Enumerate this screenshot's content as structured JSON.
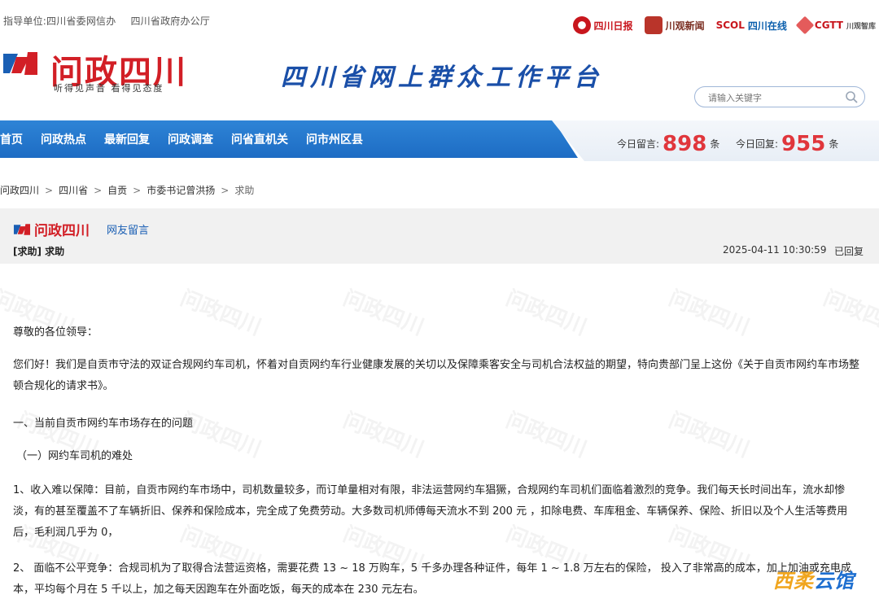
{
  "topbar": {
    "guidance_1": "指导单位:四川省委网信办",
    "guidance_2": "四川省政府办公厅",
    "partners": [
      "四川日报",
      "川观新闻",
      "SCOL",
      "四川在线",
      "CGTT",
      "川观智库"
    ]
  },
  "header": {
    "brand_name": "问政四川",
    "brand_slogan": "听得见声音  看得见态度",
    "platform_title": "四川省网上群众工作平台",
    "search_placeholder": "请输入关键字"
  },
  "nav": {
    "items": [
      "首页",
      "问政热点",
      "最新回复",
      "问政调查",
      "问省直机关",
      "问市州区县"
    ]
  },
  "stats": {
    "today_msg_label": "今日留言:",
    "today_msg_count": "898",
    "today_msg_unit": "条",
    "today_reply_label": "今日回复:",
    "today_reply_count": "955",
    "today_reply_unit": "条"
  },
  "breadcrumb": {
    "items": [
      "问政四川",
      "四川省",
      "自贡",
      "市委书记曾洪扬",
      "求助"
    ],
    "separator": ">"
  },
  "message": {
    "logo_text": "问政四川",
    "type_label": "网友留言",
    "title": "[求助] 求助",
    "date": "2025-04-11 10:30:59",
    "status": "已回复"
  },
  "body": {
    "salutation": "尊敬的各位领导：",
    "intro": "您们好！我们是自贡市守法的双证合规网约车司机，怀着对自贡网约车行业健康发展的关切以及保障乘客安全与司机合法权益的期望，特向贵部门呈上这份《关于自贡市网约车市场整顿合规化的请求书》。",
    "section_1": "一、当前自贡市网约车市场存在的问题",
    "subsection_1": "（一）网约车司机的难处",
    "point_1": "1、收入难以保障：目前，自贡市网约车市场中，司机数量较多，而订单量相对有限，非法运营网约车猖獗，合规网约车司机们面临着激烈的竞争。我们每天长时间出车，流水却惨淡，有的甚至覆盖不了车辆折旧、保养和保险成本，完全成了免费劳动。大多数司机师傅每天流水不到 200 元 ，扣除电费、车库租金、车辆保养、保险、折旧以及个人生活等费用后，毛利润几乎为 0，",
    "point_2": "2、 面临不公平竞争：合规司机为了取得合法营运资格，需要花费 13 ~ 18 万购车，5 千多办理各种证件，每年 1 ~ 1.8 万左右的保险， 投入了非常高的成本，加上加油或充电成本，平均每个月在 5 千以上，加之每天因跑车在外面吃饭，每天的成本在 230 元左右。"
  },
  "watermark_text": "问政四川",
  "corner_badge": {
    "part1": "西柔",
    "part2": "云馆"
  },
  "colors": {
    "brand_red": "#d21f26",
    "nav_blue": "#1d6cc4",
    "stat_red": "#e0363c",
    "link_blue": "#1a5fb4"
  }
}
